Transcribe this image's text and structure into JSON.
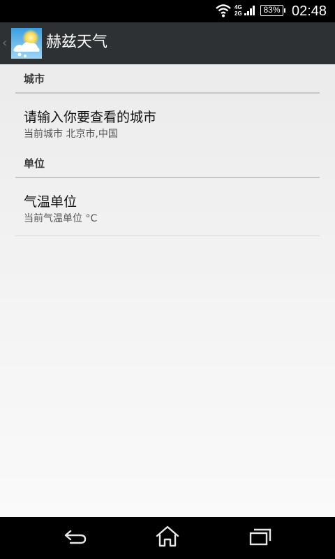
{
  "status_bar": {
    "net_top": "4G",
    "net_bottom": "2G",
    "battery": "83%",
    "time": "02:48"
  },
  "action_bar": {
    "title": "赫兹天气",
    "icon": "weather-app-icon"
  },
  "city_section": {
    "header": "城市",
    "item_title": "请输入你要查看的城市",
    "item_summary": "当前城市 北京市,中国"
  },
  "unit_section": {
    "header": "单位",
    "item_title": "气温单位",
    "item_summary": "当前气温单位  °C"
  },
  "nav": {
    "back": "back-icon",
    "home": "home-icon",
    "recents": "recents-icon"
  },
  "colors": {
    "action_bar_bg": "#2e3134",
    "divider": "#c7c7c7"
  }
}
